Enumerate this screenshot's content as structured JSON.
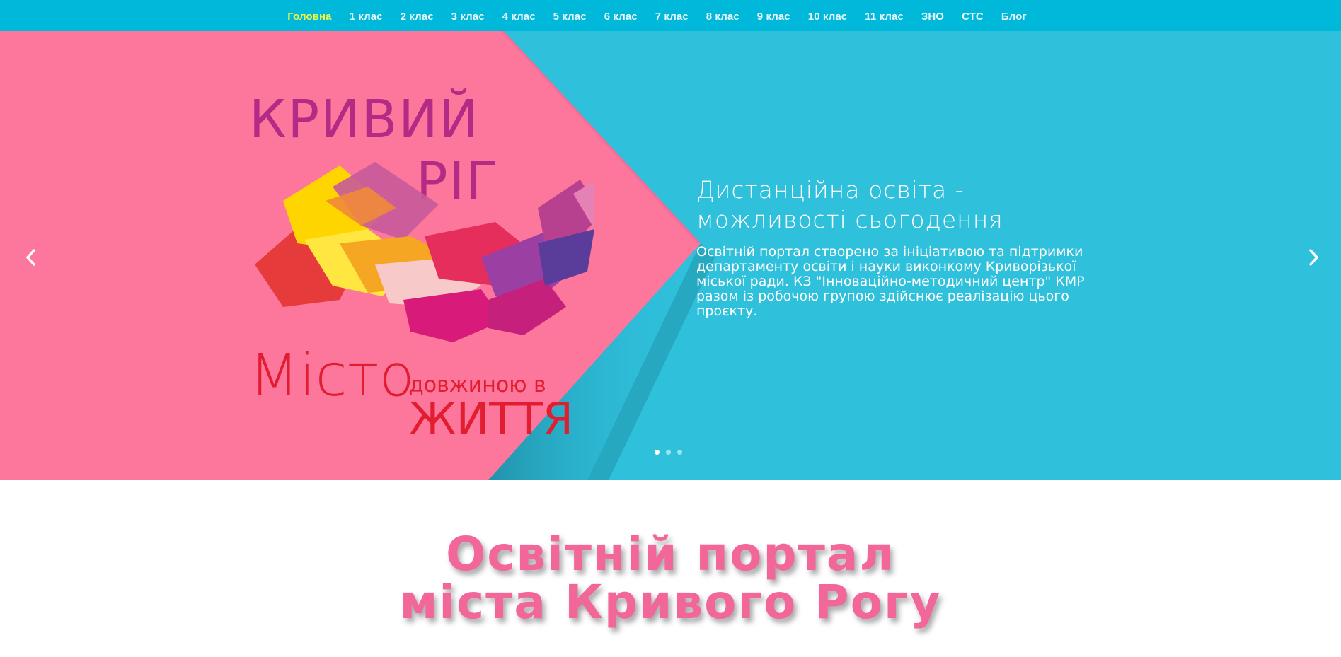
{
  "nav": {
    "items": [
      {
        "label": "Головна",
        "active": true
      },
      {
        "label": "1 клас"
      },
      {
        "label": "2 клас"
      },
      {
        "label": "3 клас"
      },
      {
        "label": "4 клас"
      },
      {
        "label": "5 клас"
      },
      {
        "label": "6 клас"
      },
      {
        "label": "7 клас"
      },
      {
        "label": "8 клас"
      },
      {
        "label": "9 клас"
      },
      {
        "label": "10 клас"
      },
      {
        "label": "11 клас"
      },
      {
        "label": "ЗНО"
      },
      {
        "label": "СТС"
      },
      {
        "label": "Блог"
      }
    ]
  },
  "slider": {
    "logo": {
      "line1": "КРИВИЙ",
      "line2": "РІГ",
      "line3": "Місто",
      "line4": "довжиною в",
      "line5": "ЖИТТЯ"
    },
    "title_line1": "Дистанційна освіта -",
    "title_line2": "можливості сьогодення",
    "text": "Освітній портал створено за ініціативою та підтримки департаменту освіти і науки виконкому Криворізької міської ради. КЗ \"Інноваційно-методичний центр\" КМР разом із робочою групою здійснює реалізацію цього проєкту.",
    "slides_count": 3,
    "active_slide": 1,
    "prev_icon": "chevron-left-icon",
    "next_icon": "chevron-right-icon"
  },
  "heading": {
    "line1": "Освітній портал",
    "line2": "міста Кривого Рогу"
  },
  "colors": {
    "nav_bg": "#00b8d9",
    "nav_active": "#f3f547",
    "slide_bg": "#2fc0dc",
    "pink": "#fd779c",
    "heading": "#f26699"
  }
}
